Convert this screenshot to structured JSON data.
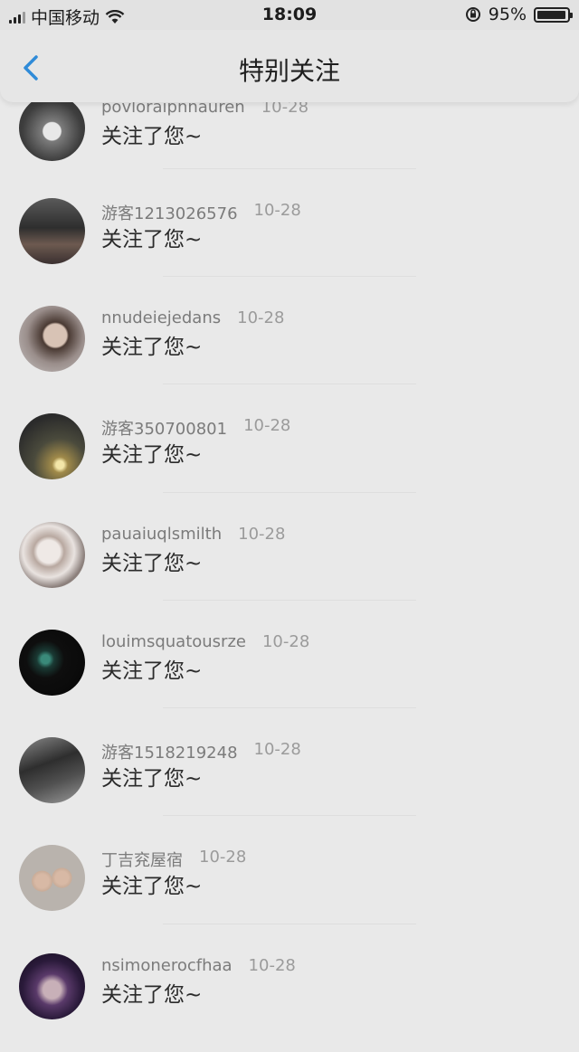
{
  "status_bar": {
    "carrier": "中国移动",
    "time": "18:09",
    "battery": "95%",
    "battery_level": 0.95
  },
  "nav": {
    "back_icon": "chevron-left-icon",
    "title": "特别关注",
    "accent": "#2f8bd8"
  },
  "items": [
    {
      "name": "povloraipnnauren",
      "date": "10-28",
      "message": "关注了您~",
      "avatar": "avatar-cup"
    },
    {
      "name": "游客1213026576",
      "date": "10-28",
      "message": "关注了您~",
      "avatar": "avatar-person"
    },
    {
      "name": "nnudeiejedans",
      "date": "10-28",
      "message": "关注了您~",
      "avatar": "avatar-girl"
    },
    {
      "name": "游客350700801",
      "date": "10-28",
      "message": "关注了您~",
      "avatar": "avatar-sunset"
    },
    {
      "name": "pauaiuqlsmilth",
      "date": "10-28",
      "message": "关注了您~",
      "avatar": "avatar-anime"
    },
    {
      "name": "louimsquatousrze",
      "date": "10-28",
      "message": "关注了您~",
      "avatar": "avatar-heart"
    },
    {
      "name": "游客1518219248",
      "date": "10-28",
      "message": "关注了您~",
      "avatar": "avatar-laptop"
    },
    {
      "name": "丁吉兖屋宿",
      "date": "10-28",
      "message": "关注了您~",
      "avatar": "avatar-fingers"
    },
    {
      "name": "nsimonerocfhaa",
      "date": "10-28",
      "message": "关注了您~",
      "avatar": "avatar-woman"
    }
  ]
}
